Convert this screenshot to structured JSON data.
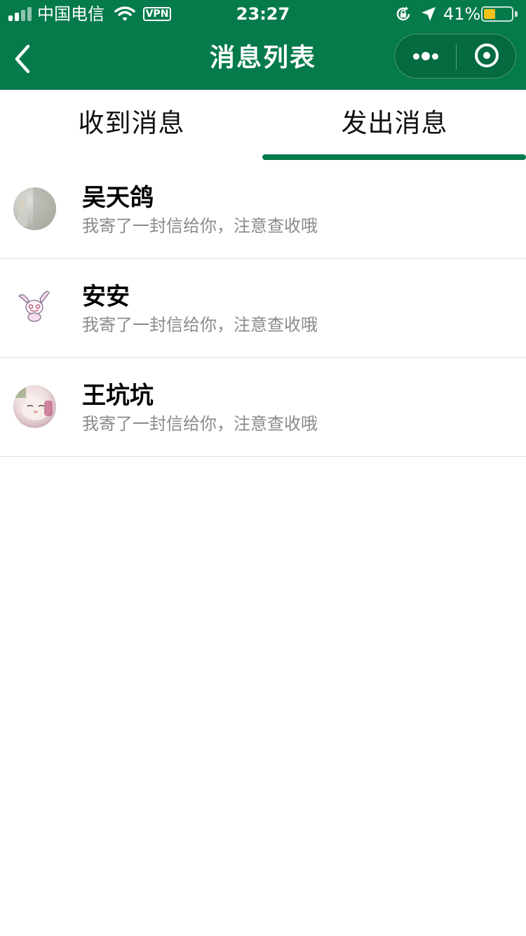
{
  "status_bar": {
    "carrier": "中国电信",
    "vpn": "VPN",
    "time": "23:27",
    "battery": "41%",
    "battery_level": 0.41,
    "battery_color": "#f2c21a"
  },
  "nav": {
    "title": "消息列表"
  },
  "tabs": [
    {
      "label": "收到消息",
      "active": false
    },
    {
      "label": "发出消息",
      "active": true
    }
  ],
  "messages": [
    {
      "name": "吴天鸽",
      "preview": "我寄了一封信给你，注意查收哦"
    },
    {
      "name": "安安",
      "preview": "我寄了一封信给你，注意查收哦"
    },
    {
      "name": "王坑坑",
      "preview": "我寄了一封信给你，注意查收哦"
    }
  ],
  "colors": {
    "brand": "#057a4b",
    "preview_text": "#8a8a8a",
    "divider": "#e3e3e3"
  },
  "icons": [
    "signal-icon",
    "wifi-icon",
    "vpn-icon",
    "rotation-lock-icon",
    "location-icon",
    "battery-icon",
    "back-icon",
    "more-icon",
    "close-miniprogram-icon"
  ]
}
